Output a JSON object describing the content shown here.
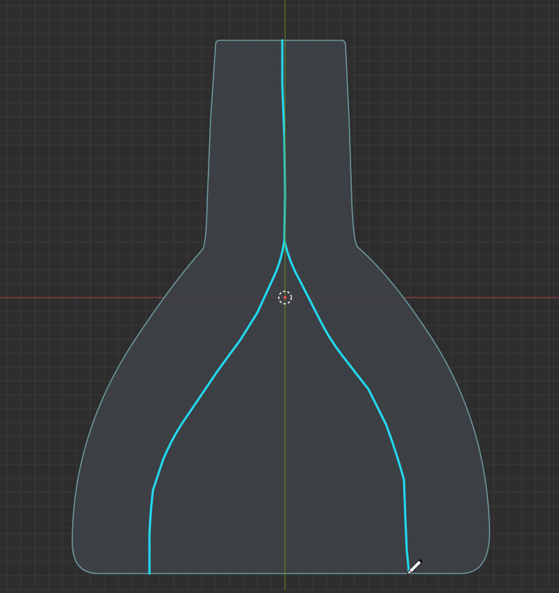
{
  "viewport": {
    "background": "#2d2d2d",
    "grid_minor_color": "#3a3a3a",
    "grid_major_color": "#424242",
    "x_axis_color": "#b8434e",
    "y_axis_color": "#6b8f1f"
  },
  "mesh": {
    "fill_color": "#404349",
    "outline_color": "#6e9aa0"
  },
  "annotation": {
    "stroke_color": "#22d8ee"
  },
  "cursor_3d": {
    "icon": "3d-cursor-icon",
    "ring_color": "#ffffff",
    "accent_color": "#e0504a"
  },
  "tool": {
    "icon": "annotate-pencil-icon"
  }
}
